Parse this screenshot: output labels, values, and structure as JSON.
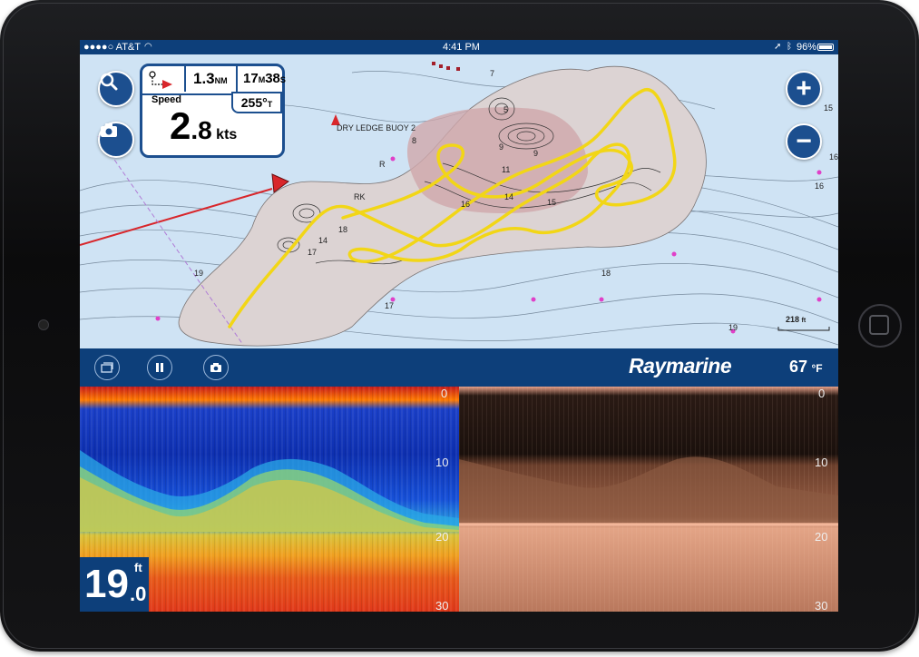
{
  "status_bar": {
    "carrier": "●●●●○ AT&T",
    "time": "4:41 PM",
    "battery": "96%"
  },
  "map": {
    "waypoint_panel": {
      "distance_value": "1.3",
      "distance_unit": "NM",
      "time_minutes": "17",
      "time_minutes_unit": "M",
      "time_seconds": "38",
      "time_seconds_unit": "S",
      "speed_label": "Speed",
      "speed_int": "2",
      "speed_dec": ".8",
      "speed_unit": "kts",
      "heading_value": "255°",
      "heading_unit": "T"
    },
    "buoy_label": "DRY LEDGE BUOY 2",
    "scale_label": "218",
    "scale_unit": "ft",
    "depth_soundings": [
      "7",
      "5",
      "8",
      "9",
      "9",
      "11",
      "14",
      "15",
      "16",
      "18",
      "14",
      "17",
      "19",
      "16",
      "15",
      "16",
      "18",
      "19",
      "17",
      "RK",
      "R"
    ],
    "icons": [
      "search-icon",
      "camera-icon",
      "zoom-in-icon",
      "zoom-out-icon"
    ]
  },
  "toolbar": {
    "brand": "Raymarine",
    "water_temp_value": "67",
    "water_temp_unit": "°F",
    "icons": [
      "layers-icon",
      "pause-icon",
      "camera-icon"
    ]
  },
  "sonar": {
    "depth_value_int": "19",
    "depth_value_dec": ".0",
    "depth_unit": "ft",
    "left_scale": [
      "0",
      "10",
      "20",
      "30"
    ],
    "right_scale": [
      "0",
      "10",
      "20",
      "30"
    ]
  },
  "colors": {
    "chrome_blue": "#0d3f7a",
    "button_blue": "#1c4f8f",
    "track_yellow": "#f2d616",
    "water": "#cfe3f4"
  }
}
